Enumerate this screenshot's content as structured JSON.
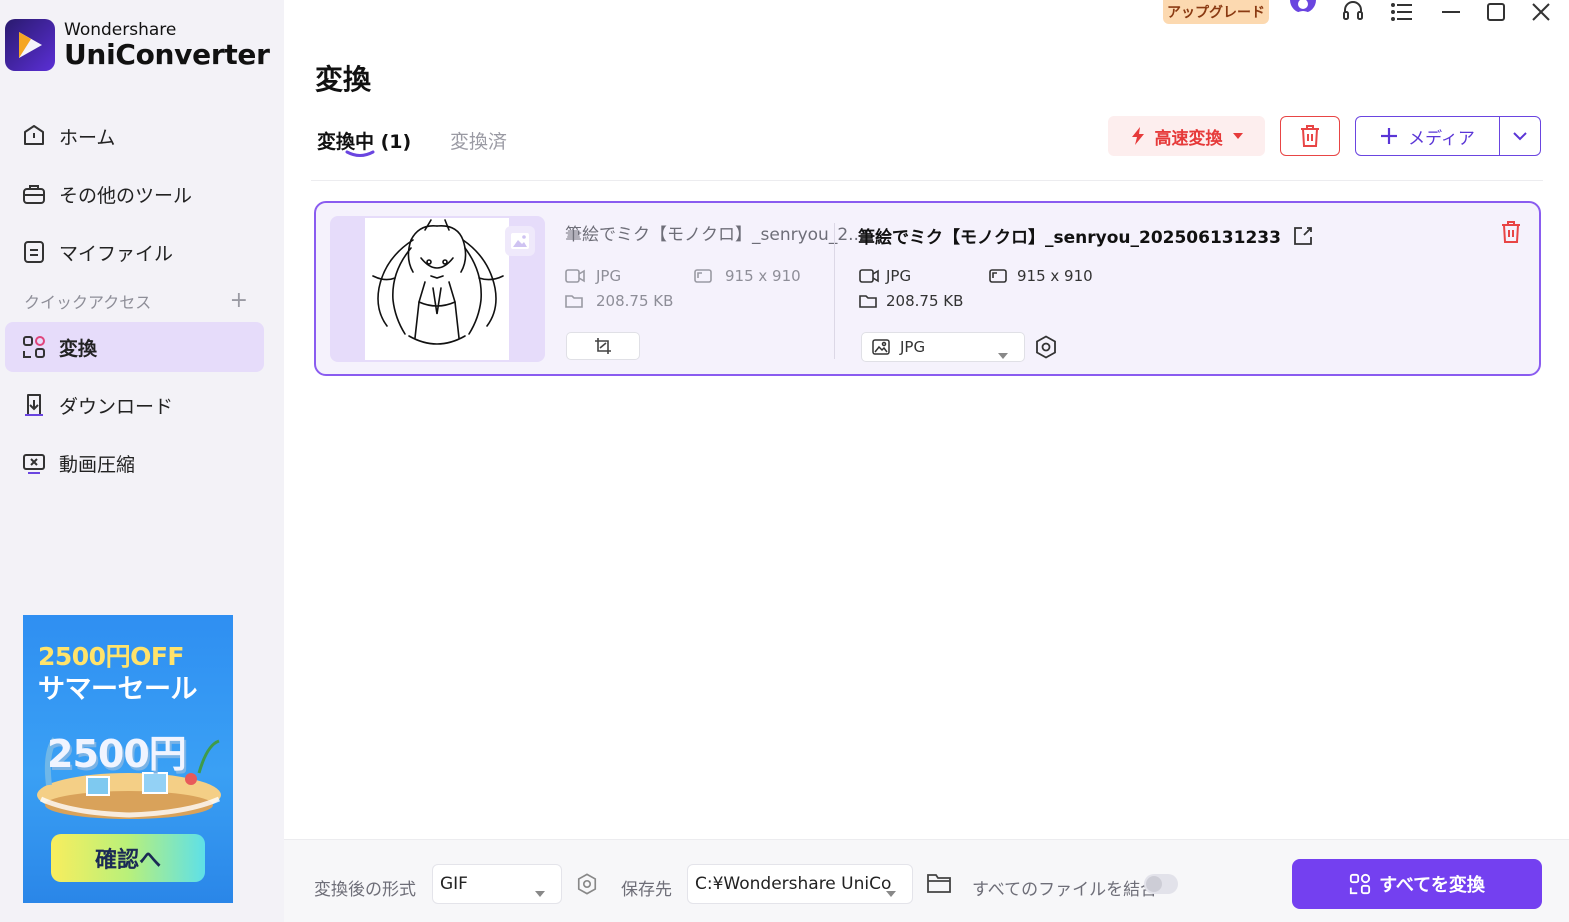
{
  "brand": {
    "sub": "Wondershare",
    "main": "UniConverter"
  },
  "sidebar": {
    "items": [
      {
        "label": "ホーム",
        "icon": "home-icon"
      },
      {
        "label": "その他のツール",
        "icon": "toolbox-icon"
      },
      {
        "label": "マイファイル",
        "icon": "file-icon"
      },
      {
        "label": "変換",
        "icon": "convert-icon",
        "active": true
      },
      {
        "label": "ダウンロード",
        "icon": "download-icon"
      },
      {
        "label": "動画圧縮",
        "icon": "compress-icon"
      }
    ],
    "quick_access": "クイックアクセス",
    "quick_add": "+"
  },
  "promo": {
    "line1": "2500円OFF",
    "line2": "サマーセール",
    "big": "2500円",
    "button": "確認へ"
  },
  "titlebar": {
    "upgrade": "アップグレード"
  },
  "main": {
    "title": "変換",
    "tabs": [
      {
        "label": "変換中 (1)",
        "active": true
      },
      {
        "label": "変換済",
        "active": false
      }
    ],
    "fast_convert": "高速変換",
    "add_media": "メディア"
  },
  "file": {
    "source_name": "筆絵でミク【モノクロ】_senryou_2...",
    "source_format": "JPG",
    "source_resolution": "915 x 910",
    "source_size": "208.75 KB",
    "output_name": "筆絵でミク【モノクロ】_senryou_202506131233",
    "output_format": "JPG",
    "output_resolution": "915 x 910",
    "output_size": "208.75 KB",
    "output_format_select": "JPG"
  },
  "bottom": {
    "format_label": "変換後の形式",
    "format_value": "GIF",
    "save_label": "保存先",
    "save_path": "C:¥Wondershare UniCo",
    "merge_label": "すべてのファイルを結合",
    "merge_enabled": false,
    "convert_all": "すべてを変換"
  },
  "colors": {
    "accent": "#7440f0",
    "danger": "#e63a3a",
    "active_bg": "#e6dcfa"
  }
}
